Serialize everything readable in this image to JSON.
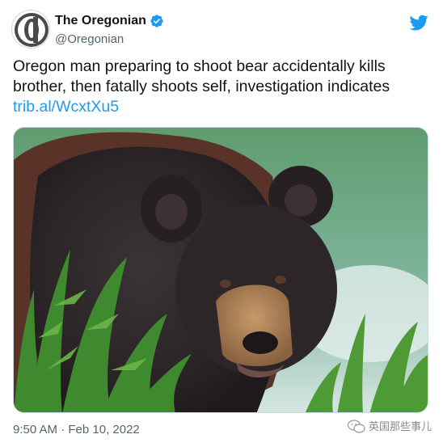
{
  "author": {
    "display_name": "The Oregonian",
    "handle": "@Oregonian",
    "avatar_icon": "oregonian-logo",
    "verified_icon": "verified-badge-icon"
  },
  "tweet": {
    "text_line1": "Oregon man preparing to shoot bear accidentally kills",
    "text_line2": "brother, then fatally shoots self, investigation indicates",
    "link": "trib.al/WcxtXu5",
    "timestamp": "9:50 AM · Feb 10, 2022"
  },
  "media": {
    "subject": "black bear among green plants"
  },
  "watermark": {
    "text": "英国那些事儿"
  },
  "colors": {
    "link": "#1d9bf0",
    "verified": "#1d9bf0",
    "secondary_text": "#536471",
    "primary_text": "#0f1419"
  }
}
